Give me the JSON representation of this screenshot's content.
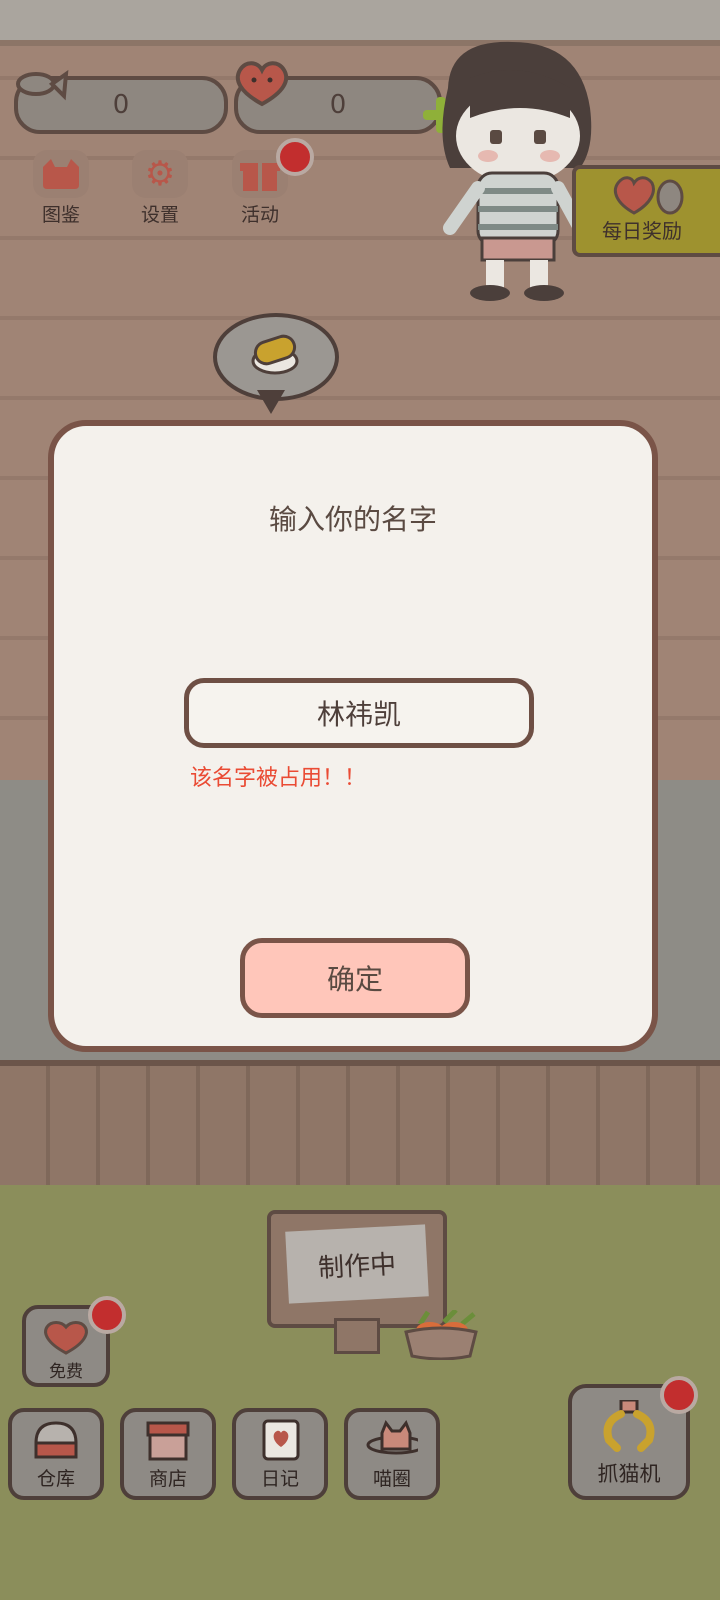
{
  "currencies": {
    "fish": {
      "value": "0",
      "icon": "fish-icon"
    },
    "hearts": {
      "value": "0",
      "icon": "heart-face-icon"
    }
  },
  "top_menu": [
    {
      "label": "图鉴",
      "icon": "cat-face-icon"
    },
    {
      "label": "设置",
      "icon": "gear-icon"
    },
    {
      "label": "活动",
      "icon": "gift-icon"
    }
  ],
  "daily_reward": {
    "label": "每日奖励"
  },
  "dialog": {
    "title": "输入你的名字",
    "name_value": "林祎凯",
    "error": "该名字被占用！！",
    "confirm": "确定"
  },
  "sign": {
    "label": "制作中"
  },
  "free": {
    "label": "免费"
  },
  "bottom_nav": [
    {
      "label": "仓库",
      "icon": "storage-pot-icon"
    },
    {
      "label": "商店",
      "icon": "shop-icon"
    },
    {
      "label": "日记",
      "icon": "diary-icon"
    },
    {
      "label": "喵圈",
      "icon": "cat-planet-icon"
    }
  ],
  "claw": {
    "label": "抓猫机",
    "icon": "claw-icon"
  },
  "colors": {
    "accent_red": "#c22e2e",
    "error": "#ea4b34",
    "confirm_bg": "#ffc6ba"
  }
}
